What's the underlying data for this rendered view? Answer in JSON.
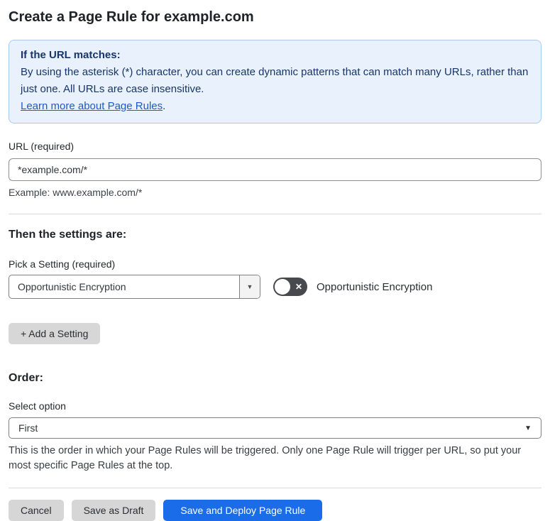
{
  "page": {
    "title": "Create a Page Rule for example.com"
  },
  "info_box": {
    "heading": "If the URL matches:",
    "body": "By using the asterisk (*) character, you can create dynamic patterns that can match many URLs, rather than just one. All URLs are case insensitive.",
    "link_label": "Learn more about Page Rules",
    "link_suffix": "."
  },
  "url_field": {
    "label": "URL (required)",
    "value": "*example.com/*",
    "example": "Example: www.example.com/*"
  },
  "settings_section": {
    "heading": "Then the settings are:",
    "picker_label": "Pick a Setting (required)",
    "picker_value": "Opportunistic Encryption",
    "toggle_label": "Opportunistic Encryption",
    "toggle_state": "off",
    "add_button_label": "+ Add a Setting"
  },
  "order_section": {
    "heading": "Order:",
    "select_label": "Select option",
    "select_value": "First",
    "help": "This is the order in which your Page Rules will be triggered. Only one Page Rule will trigger per URL, so put your most specific Page Rules at the top."
  },
  "footer": {
    "cancel_label": "Cancel",
    "save_draft_label": "Save as Draft",
    "save_deploy_label": "Save and Deploy Page Rule"
  },
  "icons": {
    "dropdown_arrow": "▼",
    "toggle_off_x": "✕"
  },
  "colors": {
    "info_bg": "#e9f2fc",
    "info_border": "#abc9ee",
    "info_text": "#17356b",
    "link": "#2057cc",
    "primary_button": "#1a6ce8",
    "gray_button": "#d6d6d6",
    "toggle_off": "#47494e"
  }
}
